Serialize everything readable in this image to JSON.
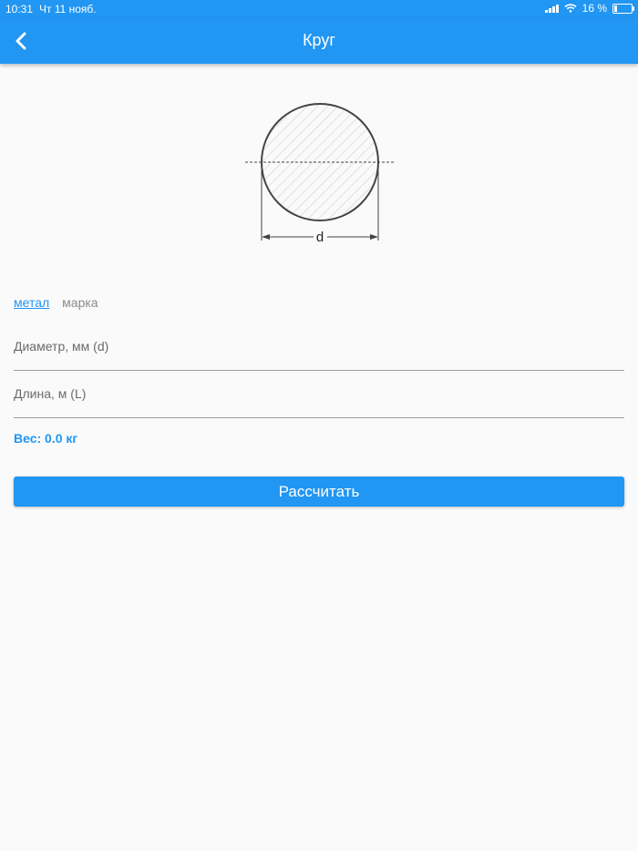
{
  "status_bar": {
    "time": "10:31",
    "date": "Чт 11 нояб.",
    "battery_percent": "16 %"
  },
  "app_bar": {
    "title": "Круг",
    "back_icon": "chevron-left-icon"
  },
  "diagram": {
    "dimension_label": "d"
  },
  "tabs": {
    "metal": "метал",
    "grade": "марка"
  },
  "form": {
    "diameter_placeholder": "Диаметр, мм (d)",
    "diameter_value": "",
    "length_placeholder": "Длина, м (L)",
    "length_value": ""
  },
  "result": {
    "weight_text": "Вес: 0.0 кг"
  },
  "actions": {
    "calculate_label": "Рассчитать"
  },
  "colors": {
    "primary": "#2196f3",
    "background": "#fafafa"
  }
}
